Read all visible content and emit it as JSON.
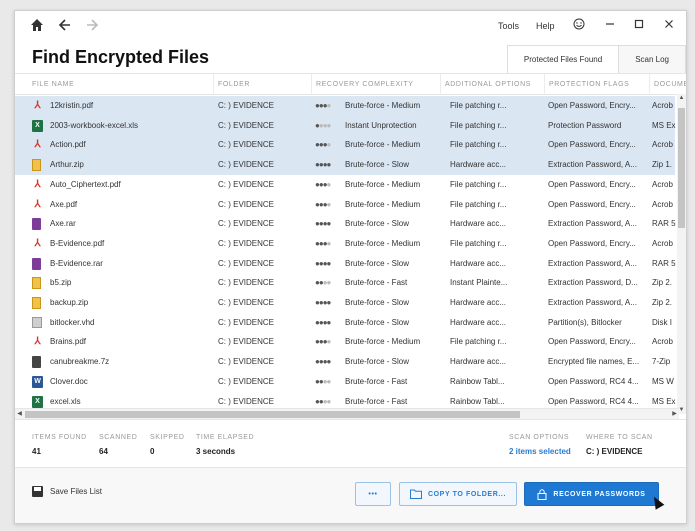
{
  "titlebar": {
    "home_icon": "home-icon",
    "back_icon": "arrow-left-icon",
    "forward_icon": "arrow-right-icon",
    "menu": [
      "Tools",
      "Help"
    ],
    "feedback_icon": "smiley-icon",
    "minimize_icon": "minimize-icon",
    "maximize_icon": "maximize-icon",
    "close_icon": "close-icon"
  },
  "page": {
    "title": "Find Encrypted Files",
    "tabs": [
      {
        "label": "Protected Files Found",
        "active": true
      },
      {
        "label": "Scan Log",
        "active": false
      }
    ]
  },
  "table": {
    "columns": [
      "FILE NAME",
      "FOLDER",
      "RECOVERY COMPLEXITY",
      "ADDITIONAL OPTIONS",
      "PROTECTION FLAGS",
      "DOCUME"
    ],
    "rows": [
      {
        "name": "12kristin.pdf",
        "type": "pdf",
        "folder": "C: ) EVIDENCE",
        "level": 3,
        "complexity": "Brute-force - Medium",
        "options": "File patching r...",
        "flags": "Open Password, Encry...",
        "doc": "Acrob",
        "selected": true
      },
      {
        "name": "2003-workbook-excel.xls",
        "type": "xls",
        "folder": "C: ) EVIDENCE",
        "level": 1,
        "complexity": "Instant Unprotection",
        "options": "File patching r...",
        "flags": "Protection Password",
        "doc": "MS Ex",
        "selected": true
      },
      {
        "name": "Action.pdf",
        "type": "pdf",
        "folder": "C: ) EVIDENCE",
        "level": 3,
        "complexity": "Brute-force - Medium",
        "options": "File patching r...",
        "flags": "Open Password, Encry...",
        "doc": "Acrob",
        "selected": true
      },
      {
        "name": "Arthur.zip",
        "type": "zip",
        "folder": "C: ) EVIDENCE",
        "level": 4,
        "complexity": "Brute-force - Slow",
        "options": "Hardware acc...",
        "flags": "Extraction Password, A...",
        "doc": "Zip 1.",
        "selected": true
      },
      {
        "name": "Auto_Ciphertext.pdf",
        "type": "pdf",
        "folder": "C: ) EVIDENCE",
        "level": 3,
        "complexity": "Brute-force - Medium",
        "options": "File patching r...",
        "flags": "Open Password, Encry...",
        "doc": "Acrob",
        "selected": false
      },
      {
        "name": "Axe.pdf",
        "type": "pdf",
        "folder": "C: ) EVIDENCE",
        "level": 3,
        "complexity": "Brute-force - Medium",
        "options": "File patching r...",
        "flags": "Open Password, Encry...",
        "doc": "Acrob",
        "selected": false
      },
      {
        "name": "Axe.rar",
        "type": "rar",
        "folder": "C: ) EVIDENCE",
        "level": 4,
        "complexity": "Brute-force - Slow",
        "options": "Hardware acc...",
        "flags": "Extraction Password, A...",
        "doc": "RAR 5",
        "selected": false
      },
      {
        "name": "B-Evidence.pdf",
        "type": "pdf",
        "folder": "C: ) EVIDENCE",
        "level": 3,
        "complexity": "Brute-force - Medium",
        "options": "File patching r...",
        "flags": "Open Password, Encry...",
        "doc": "Acrob",
        "selected": false
      },
      {
        "name": "B-Evidence.rar",
        "type": "rar",
        "folder": "C: ) EVIDENCE",
        "level": 4,
        "complexity": "Brute-force - Slow",
        "options": "Hardware acc...",
        "flags": "Extraction Password, A...",
        "doc": "RAR 5",
        "selected": false
      },
      {
        "name": "b5.zip",
        "type": "zip",
        "folder": "C: ) EVIDENCE",
        "level": 2,
        "complexity": "Brute-force - Fast",
        "options": "Instant Plainte...",
        "flags": "Extraction Password, D...",
        "doc": "Zip 2.",
        "selected": false
      },
      {
        "name": "backup.zip",
        "type": "zip",
        "folder": "C: ) EVIDENCE",
        "level": 4,
        "complexity": "Brute-force - Slow",
        "options": "Hardware acc...",
        "flags": "Extraction Password, A...",
        "doc": "Zip 2.",
        "selected": false
      },
      {
        "name": "bitlocker.vhd",
        "type": "vhd",
        "folder": "C: ) EVIDENCE",
        "level": 4,
        "complexity": "Brute-force - Slow",
        "options": "Hardware acc...",
        "flags": "Partition(s), Bitlocker",
        "doc": "Disk I",
        "selected": false
      },
      {
        "name": "Brains.pdf",
        "type": "pdf",
        "folder": "C: ) EVIDENCE",
        "level": 3,
        "complexity": "Brute-force - Medium",
        "options": "File patching r...",
        "flags": "Open Password, Encry...",
        "doc": "Acrob",
        "selected": false
      },
      {
        "name": "canubreakme.7z",
        "type": "7z",
        "folder": "C: ) EVIDENCE",
        "level": 4,
        "complexity": "Brute-force - Slow",
        "options": "Hardware acc...",
        "flags": "Encrypted file names, E...",
        "doc": "7-Zip",
        "selected": false
      },
      {
        "name": "Clover.doc",
        "type": "doc",
        "folder": "C: ) EVIDENCE",
        "level": 2,
        "complexity": "Brute-force - Fast",
        "options": "Rainbow Tabl...",
        "flags": "Open Password, RC4 4...",
        "doc": "MS W",
        "selected": false
      },
      {
        "name": "excel.xls",
        "type": "xls",
        "folder": "C: ) EVIDENCE",
        "level": 2,
        "complexity": "Brute-force - Fast",
        "options": "Rainbow Tabl...",
        "flags": "Open Password, RC4 4...",
        "doc": "MS Ex",
        "selected": false
      }
    ]
  },
  "summary": {
    "items_found_label": "ITEMS FOUND",
    "items_found": "41",
    "scanned_label": "SCANNED",
    "scanned": "64",
    "skipped_label": "SKIPPED",
    "skipped": "0",
    "elapsed_label": "TIME ELAPSED",
    "elapsed": "3 seconds",
    "scan_options_label": "SCAN OPTIONS",
    "scan_options": "2 items selected",
    "where_label": "WHERE TO SCAN",
    "where": "C: ) EVIDENCE"
  },
  "footer": {
    "save_label": "Save Files List",
    "more_label": "•••",
    "copy_label": "COPY TO FOLDER...",
    "recover_label": "RECOVER PASSWORDS"
  },
  "colors": {
    "accent": "#1f78d1",
    "selection": "#dbe6f3",
    "pdf": "#d9342b"
  }
}
